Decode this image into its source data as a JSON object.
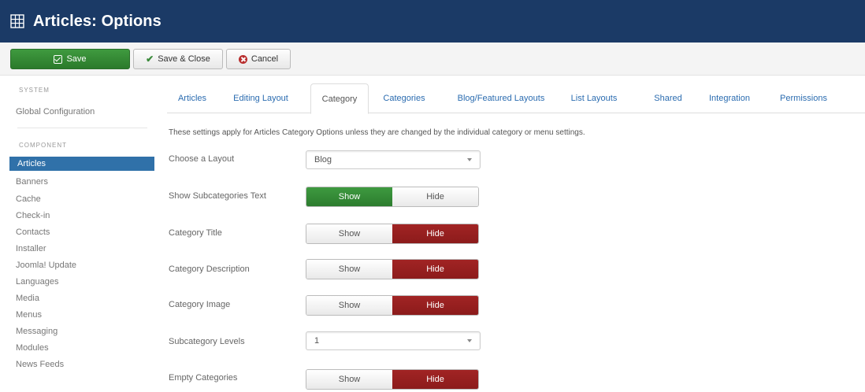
{
  "header": {
    "title": "Articles: Options",
    "icon": "options-grid-icon",
    "bg_color": "#1b3a66"
  },
  "toolbar": {
    "save_label": "Save",
    "save_close_label": "Save & Close",
    "cancel_label": "Cancel"
  },
  "sidebar": {
    "system_heading": "SYSTEM",
    "global_configuration": "Global Configuration",
    "component_heading": "COMPONENT",
    "items": [
      "Articles",
      "Banners",
      "Cache",
      "Check-in",
      "Contacts",
      "Installer",
      "Joomla! Update",
      "Languages",
      "Media",
      "Menus",
      "Messaging",
      "Modules",
      "News Feeds"
    ],
    "active_item": "Articles",
    "active_color": "#3071a9"
  },
  "tabs": [
    "Articles",
    "Editing Layout",
    "Category",
    "Categories",
    "Blog/Featured Layouts",
    "List Layouts",
    "Shared",
    "Integration",
    "Permissions"
  ],
  "active_tab": "Category",
  "intro": "These settings apply for Articles Category Options unless they are changed by the individual category or menu settings.",
  "fields": {
    "choose_layout": {
      "label": "Choose a Layout",
      "value": "Blog"
    },
    "show_subcategories_text": {
      "label": "Show Subcategories Text",
      "show": "Show",
      "hide": "Hide",
      "selected": "Show"
    },
    "category_title": {
      "label": "Category Title",
      "show": "Show",
      "hide": "Hide",
      "selected": "Hide"
    },
    "category_description": {
      "label": "Category Description",
      "show": "Show",
      "hide": "Hide",
      "selected": "Hide"
    },
    "category_image": {
      "label": "Category Image",
      "show": "Show",
      "hide": "Hide",
      "selected": "Hide"
    },
    "subcategory_levels": {
      "label": "Subcategory Levels",
      "value": "1"
    },
    "empty_categories": {
      "label": "Empty Categories",
      "show": "Show",
      "hide": "Hide",
      "selected": "Hide"
    }
  },
  "colors": {
    "show_on": "#2c7c2e",
    "hide_on": "#8c1b1b",
    "link": "#2b6cb0"
  }
}
